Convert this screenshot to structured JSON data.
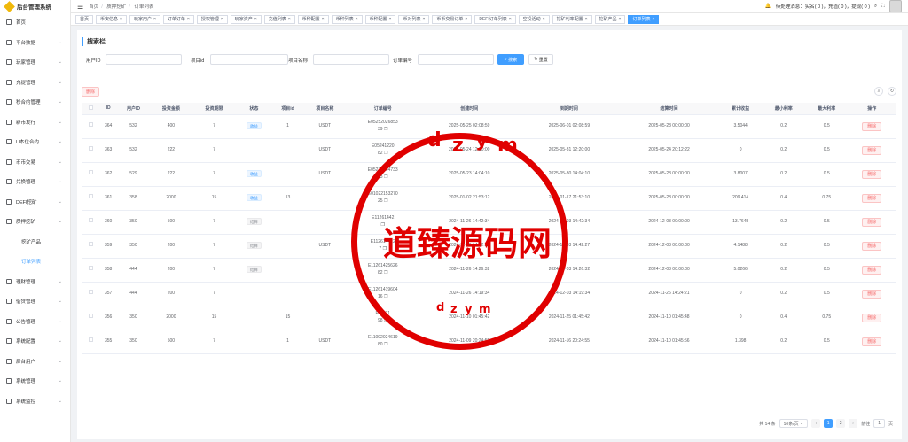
{
  "app": {
    "title": "后台管理系统"
  },
  "sidebar": {
    "items": [
      {
        "label": "首页",
        "arrow": false
      },
      {
        "label": "平台数据",
        "arrow": true
      },
      {
        "label": "玩家管理",
        "arrow": true
      },
      {
        "label": "充提管理",
        "arrow": true
      },
      {
        "label": "秒合约管理",
        "arrow": true
      },
      {
        "label": "新币发行",
        "arrow": true
      },
      {
        "label": "U本位合约",
        "arrow": true
      },
      {
        "label": "币币交易",
        "arrow": true
      },
      {
        "label": "兑换管理",
        "arrow": true
      },
      {
        "label": "DEFI挖矿",
        "arrow": true
      },
      {
        "label": "质押挖矿",
        "arrow": true
      }
    ],
    "sub_items": [
      {
        "label": "挖矿产品"
      },
      {
        "label": "订单列表"
      }
    ],
    "items_after": [
      {
        "label": "理财管理"
      },
      {
        "label": "借贷管理"
      },
      {
        "label": "公告管理"
      },
      {
        "label": "系统配置"
      },
      {
        "label": "后台用户"
      },
      {
        "label": "系统管理"
      },
      {
        "label": "系统监控"
      }
    ]
  },
  "topbar": {
    "crumbs": [
      "首页",
      "质押挖矿",
      "订单列表"
    ],
    "notice": "待处理消息：实名( 0 )，充值( 0 )，提现( 0 )"
  },
  "tabs": [
    {
      "label": "首页",
      "active": false
    },
    {
      "label": "币安信息",
      "active": false
    },
    {
      "label": "玩家用户",
      "active": false
    },
    {
      "label": "订单订单",
      "active": false
    },
    {
      "label": "授权管理",
      "active": false
    },
    {
      "label": "玩家资产",
      "active": false
    },
    {
      "label": "充值列表",
      "active": false
    },
    {
      "label": "币种配置",
      "active": false
    },
    {
      "label": "币种列表",
      "active": false
    },
    {
      "label": "币种配置",
      "active": false
    },
    {
      "label": "币对列表",
      "active": false
    },
    {
      "label": "币币交易订单",
      "active": false
    },
    {
      "label": "DEFI订单列表",
      "active": false
    },
    {
      "label": "空投活动",
      "active": false
    },
    {
      "label": "挖矿利率配置",
      "active": false
    },
    {
      "label": "挖矿产品",
      "active": false
    },
    {
      "label": "订单列表",
      "active": true
    }
  ],
  "search": {
    "title": "搜索栏",
    "user_id_label": "用户ID",
    "project_id_label": "项目id",
    "project_name_label": "项目名称",
    "order_no_label": "订单编号",
    "search_btn": "搜索",
    "reset_btn": "重置"
  },
  "toolbar": {
    "delete_label": "删除"
  },
  "table": {
    "columns": [
      "ID",
      "用户ID",
      "投资金额",
      "投资期限",
      "状态",
      "项目id",
      "项目名称",
      "订单编号",
      "创建时间",
      "到期时间",
      "结算时间",
      "累计收益",
      "最小利率",
      "最大利率",
      "操作"
    ],
    "action_label": "删除",
    "rows": [
      {
        "id": "364",
        "uid": "532",
        "amount": "400",
        "days": "7",
        "status": "收益",
        "status_color": "blue",
        "pid": "1",
        "pname": "USDT",
        "order1": "E05252026853",
        "order2": "39",
        "created": "2025-05-25 02:08:59",
        "expire": "2025-06-01 02:08:59",
        "settle": "2025-05-28 00:00:00",
        "income": "3.5044",
        "min": "0.2",
        "max": "0.5"
      },
      {
        "id": "363",
        "uid": "532",
        "amount": "222",
        "days": "7",
        "status": "",
        "status_color": "blue",
        "pid": "",
        "pname": "USDT",
        "order1": "E05241220",
        "order2": "82",
        "created": "2025-05-24 12:20:00",
        "expire": "2025-05-31 12:20:00",
        "settle": "2025-05-24 20:12:22",
        "income": "0",
        "min": "0.2",
        "max": "0.5"
      },
      {
        "id": "362",
        "uid": "529",
        "amount": "222",
        "days": "7",
        "status": "收益",
        "status_color": "blue",
        "pid": "",
        "pname": "USDT",
        "order1": "E05231404733",
        "order2": "83",
        "created": "2025-05-23 14:04:10",
        "expire": "2025-05-30 14:04:10",
        "settle": "2025-05-28 00:00:00",
        "income": "3.8007",
        "min": "0.2",
        "max": "0.5"
      },
      {
        "id": "361",
        "uid": "358",
        "amount": "2000",
        "days": "15",
        "status": "收益",
        "status_color": "blue",
        "pid": "13",
        "pname": "",
        "order1": "E01022153270",
        "order2": "25",
        "created": "2025-01-02 21:53:12",
        "expire": "2025-01-17 21:53:10",
        "settle": "2025-05-28 00:00:00",
        "income": "209.414",
        "min": "0.4",
        "max": "0.75"
      },
      {
        "id": "360",
        "uid": "350",
        "amount": "500",
        "days": "7",
        "status": "结算",
        "status_color": "gray",
        "pid": "",
        "pname": "",
        "order1": "E11261442",
        "order2": "",
        "created": "2024-11-26 14:42:34",
        "expire": "2024-12-03 14:42:34",
        "settle": "2024-12-03 00:00:00",
        "income": "13.7645",
        "min": "0.2",
        "max": "0.5"
      },
      {
        "id": "359",
        "uid": "350",
        "amount": "200",
        "days": "7",
        "status": "结算",
        "status_color": "gray",
        "pid": "",
        "pname": "USDT",
        "order1": "E112614422",
        "order2": "7",
        "created": "2024-11-26 14:42:27",
        "expire": "2024-12-03 14:42:27",
        "settle": "2024-12-03 00:00:00",
        "income": "4.1488",
        "min": "0.2",
        "max": "0.5"
      },
      {
        "id": "358",
        "uid": "444",
        "amount": "200",
        "days": "7",
        "status": "结算",
        "status_color": "gray",
        "pid": "",
        "pname": "",
        "order1": "E11261425626",
        "order2": "82",
        "created": "2024-11-26 14:26:32",
        "expire": "2024-12-03 14:26:32",
        "settle": "2024-12-03 00:00:00",
        "income": "5.0266",
        "min": "0.2",
        "max": "0.5"
      },
      {
        "id": "357",
        "uid": "444",
        "amount": "200",
        "days": "7",
        "status": "",
        "status_color": "blue",
        "pid": "",
        "pname": "",
        "order1": "E11261419604",
        "order2": "16",
        "created": "2024-11-26 14:19:34",
        "expire": "2024-12-03 14:19:34",
        "settle": "2024-11-26 14:24:21",
        "income": "0",
        "min": "0.2",
        "max": "0.5"
      },
      {
        "id": "356",
        "uid": "350",
        "amount": "2000",
        "days": "15",
        "status": "",
        "status_color": "blue",
        "pid": "15",
        "pname": "",
        "order1": "E11101",
        "order2": "98",
        "created": "2024-11-10 01:45:42",
        "expire": "2024-11-25 01:45:42",
        "settle": "2024-11-10 01:45:48",
        "income": "0",
        "min": "0.4",
        "max": "0.75"
      },
      {
        "id": "355",
        "uid": "350",
        "amount": "500",
        "days": "7",
        "status": "",
        "status_color": "blue",
        "pid": "1",
        "pname": "USDT",
        "order1": "E11092024619",
        "order2": "80",
        "created": "2024-11-09 20:24:55",
        "expire": "2024-11-16 20:24:55",
        "settle": "2024-11-10 01:45:56",
        "income": "1.398",
        "min": "0.2",
        "max": "0.5"
      }
    ]
  },
  "pagination": {
    "total": "共 14 条",
    "page_size": "10条/页",
    "pages": [
      "1",
      "2"
    ],
    "current": "1",
    "goto_label": "前往",
    "goto_value": "1",
    "page_unit": "页"
  },
  "watermark": {
    "text_cn": "道臻源码网",
    "letters_top": [
      "d",
      "z",
      "y",
      "m"
    ],
    "letters_bottom": [
      "d",
      "z",
      "y",
      "m"
    ]
  }
}
